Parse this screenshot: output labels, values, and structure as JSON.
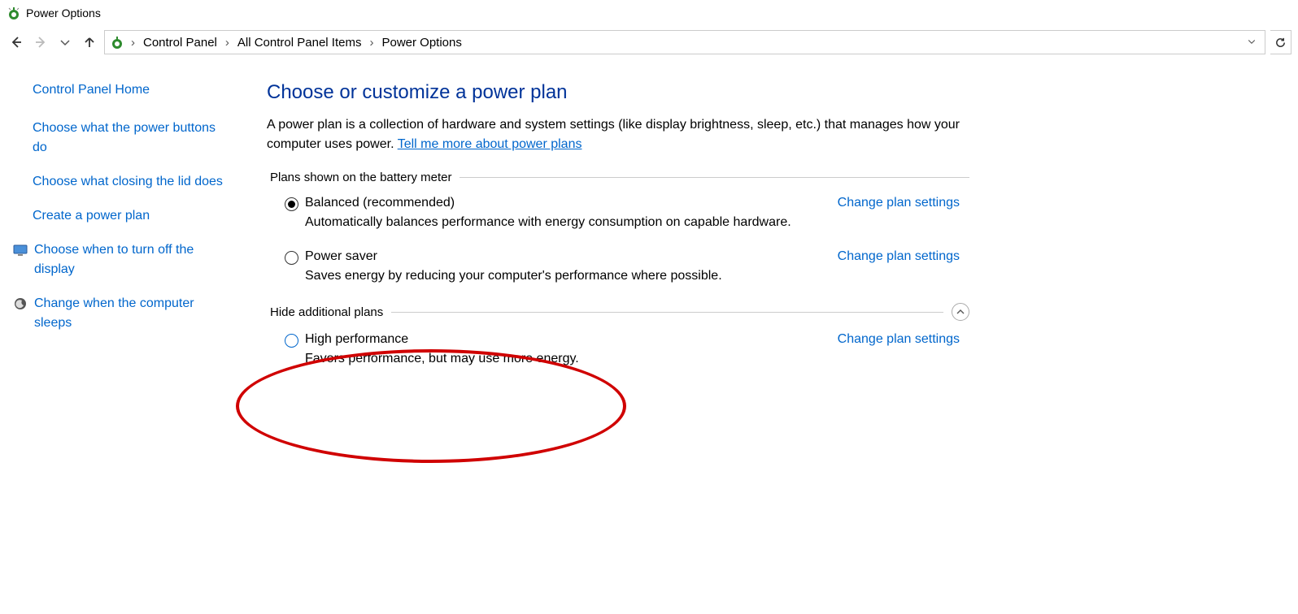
{
  "window": {
    "title": "Power Options"
  },
  "breadcrumbs": {
    "items": [
      "Control Panel",
      "All Control Panel Items",
      "Power Options"
    ]
  },
  "sidebar": {
    "home": "Control Panel Home",
    "links": {
      "buttons": "Choose what the power buttons do",
      "lid": "Choose what closing the lid does",
      "create": "Create a power plan",
      "display": "Choose when to turn off the display",
      "sleep": "Change when the computer sleeps"
    }
  },
  "main": {
    "heading": "Choose or customize a power plan",
    "desc_pre": "A power plan is a collection of hardware and system settings (like display brightness, sleep, etc.) that manages how your computer uses power. ",
    "desc_link": "Tell me more about power plans",
    "section1": "Plans shown on the battery meter",
    "section2": "Hide additional plans",
    "change": "Change plan settings",
    "plans": {
      "balanced": {
        "title": "Balanced (recommended)",
        "desc": "Automatically balances performance with energy consumption on capable hardware."
      },
      "saver": {
        "title": "Power saver",
        "desc": "Saves energy by reducing your computer's performance where possible."
      },
      "high": {
        "title": "High performance",
        "desc": "Favors performance, but may use more energy."
      }
    }
  }
}
